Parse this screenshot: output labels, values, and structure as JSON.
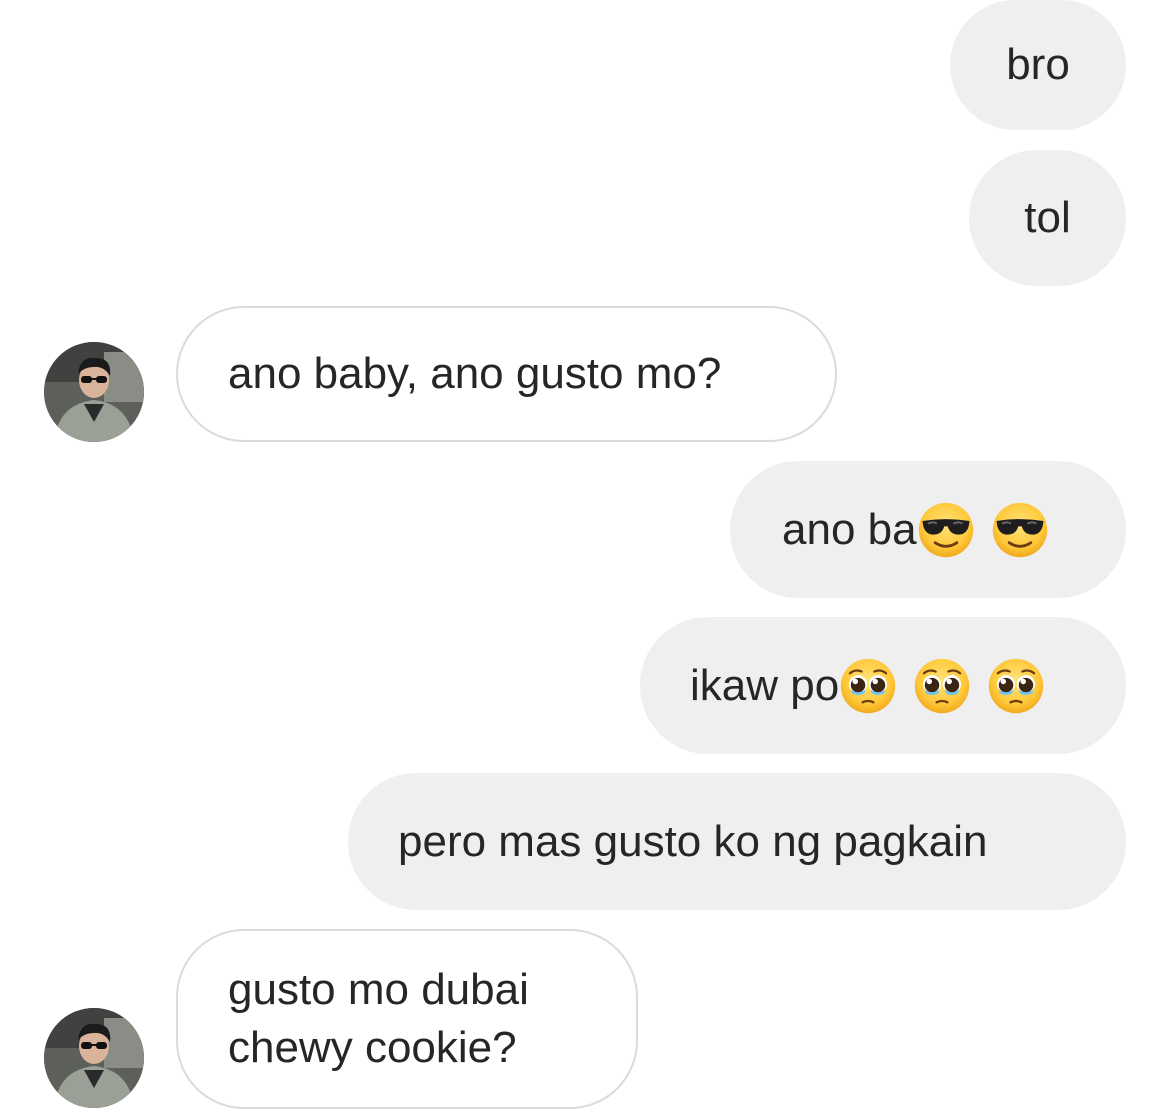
{
  "messages": [
    {
      "from": "me",
      "text": "bro"
    },
    {
      "from": "me",
      "text": "tol"
    },
    {
      "from": "them",
      "text": "ano baby, ano gusto mo?"
    },
    {
      "from": "me",
      "text": "ano ba",
      "emojis": [
        "smiling-face-with-sunglasses",
        "smiling-face-with-sunglasses"
      ]
    },
    {
      "from": "me",
      "text": "ikaw po",
      "emojis": [
        "pleading-face",
        "pleading-face",
        "pleading-face"
      ]
    },
    {
      "from": "me",
      "text": "pero mas gusto ko ng pagkain"
    },
    {
      "from": "them",
      "text_lines": [
        "gusto mo dubai",
        "chewy cookie?"
      ]
    }
  ],
  "colors": {
    "sent_bubble": "#efefef",
    "received_bubble_border": "#dbdbdb",
    "text": "#262626"
  }
}
